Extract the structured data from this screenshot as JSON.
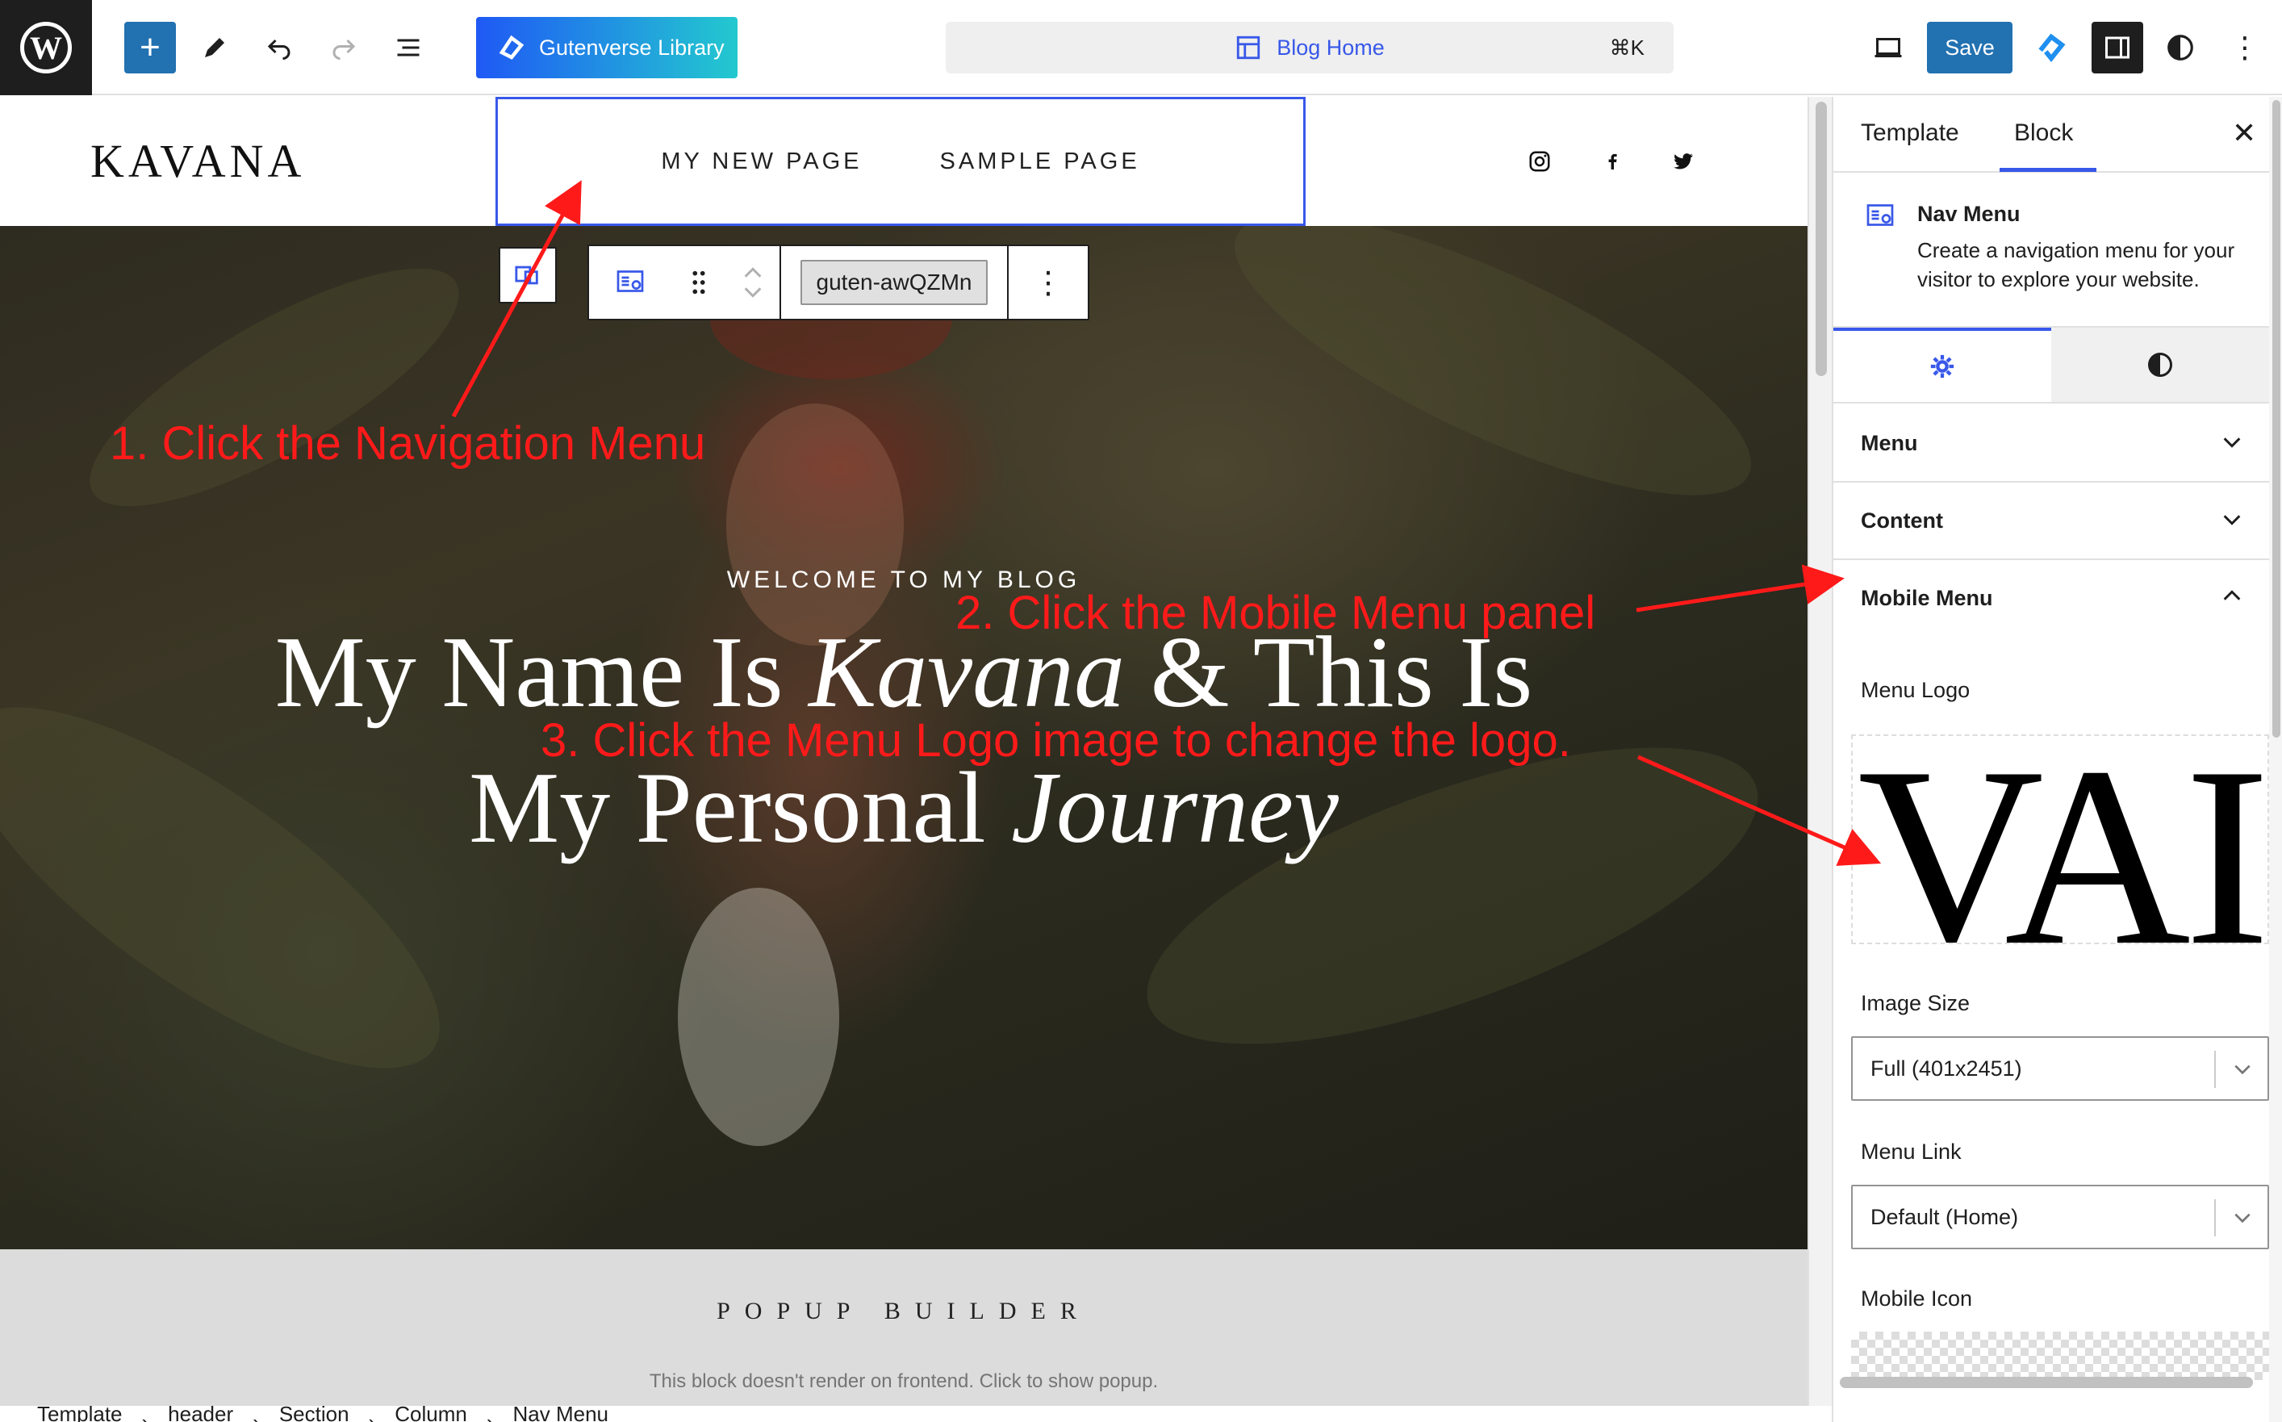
{
  "topbar": {
    "wp_logo": "W",
    "add_icon": "+",
    "gutenverse_label": "Gutenverse Library",
    "command_title": "Blog Home",
    "command_shortcut": "⌘K",
    "save_label": "Save",
    "more_icon": "⋮"
  },
  "site": {
    "logo": "KAVANA",
    "nav_items": [
      "MY NEW PAGE",
      "SAMPLE PAGE"
    ],
    "social": [
      "instagram-icon",
      "facebook-icon",
      "twitter-icon"
    ]
  },
  "hero": {
    "subtitle": "WELCOME TO MY BLOG",
    "title_line1_a": "My Name Is ",
    "title_line1_em": "Kavana",
    "title_line1_b": " & This Is",
    "title_line2_a": "My Personal ",
    "title_line2_em": "Journey"
  },
  "popup": {
    "title": "POPUP BUILDER",
    "note": "This block doesn't render on frontend. Click to show popup."
  },
  "block_toolbar": {
    "anchor": "guten-awQZMn",
    "more_icon": "⋮"
  },
  "breadcrumb": [
    "Template",
    "header",
    "Section",
    "Column",
    "Nav Menu"
  ],
  "sidebar": {
    "tabs": [
      "Template",
      "Block"
    ],
    "active_tab": "Block",
    "close_icon": "✕",
    "block_title": "Nav Menu",
    "block_desc": "Create a navigation menu for your visitor to explore your website.",
    "panels": [
      {
        "label": "Menu",
        "state": "collapsed"
      },
      {
        "label": "Content",
        "state": "collapsed"
      },
      {
        "label": "Mobile Menu",
        "state": "expanded"
      }
    ],
    "menu_logo_label": "Menu Logo",
    "menu_logo_preview": "VAI",
    "image_size_label": "Image Size",
    "image_size_value": "Full (401x2451)",
    "menu_link_label": "Menu Link",
    "menu_link_value": "Default (Home)",
    "mobile_icon_label": "Mobile Icon"
  },
  "annotations": {
    "step1": "1. Click the Navigation Menu",
    "step2": "2. Click the Mobile Menu panel",
    "step3": "3. Click the Menu Logo image to change the logo."
  },
  "colors": {
    "accent": "#3858e9",
    "save": "#2271b1",
    "annotation": "#ff1a1a"
  }
}
